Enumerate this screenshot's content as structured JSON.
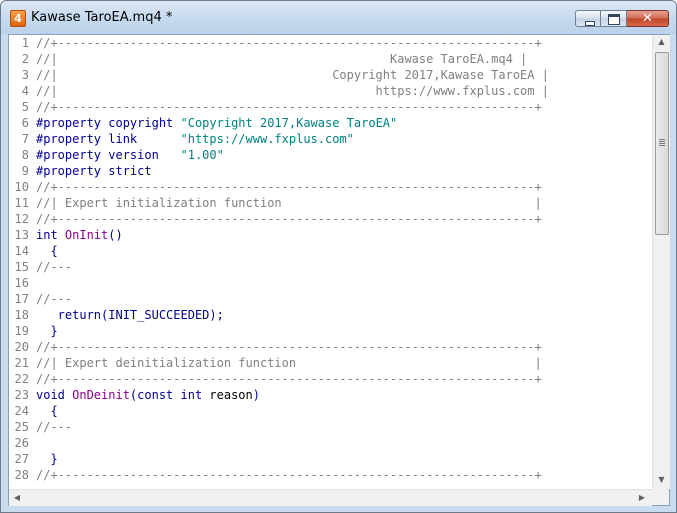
{
  "window": {
    "title": "Kawase TaroEA.mq4 *",
    "app_icon_glyph": "4",
    "close_glyph": "✕"
  },
  "colors": {
    "comment": "#808080",
    "keyword": "#00008b",
    "string": "#008080",
    "function": "#8b008b",
    "plain": "#000000"
  },
  "scrollbar": {
    "up_arrow": "▲",
    "down_arrow": "▼",
    "left_arrow": "◀",
    "right_arrow": "▶"
  },
  "editor": {
    "lines": [
      {
        "n": "1",
        "tokens": [
          {
            "t": "//+------------------------------------------------------------------+",
            "c": "comment"
          }
        ]
      },
      {
        "n": "2",
        "tokens": [
          {
            "t": "//|                                              Kawase TaroEA.mq4 |",
            "c": "comment"
          }
        ]
      },
      {
        "n": "3",
        "tokens": [
          {
            "t": "//|                                      Copyright 2017,Kawase TaroEA |",
            "c": "comment"
          }
        ]
      },
      {
        "n": "4",
        "tokens": [
          {
            "t": "//|                                            https://www.fxplus.com |",
            "c": "comment"
          }
        ]
      },
      {
        "n": "5",
        "tokens": [
          {
            "t": "//+------------------------------------------------------------------+",
            "c": "comment"
          }
        ]
      },
      {
        "n": "6",
        "tokens": [
          {
            "t": "#property copyright ",
            "c": "keyword"
          },
          {
            "t": "\"Copyright 2017,Kawase TaroEA\"",
            "c": "string"
          }
        ]
      },
      {
        "n": "7",
        "tokens": [
          {
            "t": "#property link      ",
            "c": "keyword"
          },
          {
            "t": "\"https://www.fxplus.com\"",
            "c": "string"
          }
        ]
      },
      {
        "n": "8",
        "tokens": [
          {
            "t": "#property version   ",
            "c": "keyword"
          },
          {
            "t": "\"1.00\"",
            "c": "string"
          }
        ]
      },
      {
        "n": "9",
        "tokens": [
          {
            "t": "#property strict",
            "c": "keyword"
          }
        ]
      },
      {
        "n": "10",
        "tokens": [
          {
            "t": "//+------------------------------------------------------------------+",
            "c": "comment"
          }
        ]
      },
      {
        "n": "11",
        "tokens": [
          {
            "t": "//| Expert initialization function                                   |",
            "c": "comment"
          }
        ]
      },
      {
        "n": "12",
        "tokens": [
          {
            "t": "//+------------------------------------------------------------------+",
            "c": "comment"
          }
        ]
      },
      {
        "n": "13",
        "tokens": [
          {
            "t": "int ",
            "c": "keyword"
          },
          {
            "t": "OnInit",
            "c": "function"
          },
          {
            "t": "()",
            "c": "keyword"
          }
        ]
      },
      {
        "n": "14",
        "tokens": [
          {
            "t": "  {",
            "c": "keyword"
          }
        ]
      },
      {
        "n": "15",
        "tokens": [
          {
            "t": "//---",
            "c": "comment"
          }
        ]
      },
      {
        "n": "16",
        "tokens": []
      },
      {
        "n": "17",
        "tokens": [
          {
            "t": "//---",
            "c": "comment"
          }
        ]
      },
      {
        "n": "18",
        "tokens": [
          {
            "t": "   return",
            "c": "keyword"
          },
          {
            "t": "(INIT_SUCCEEDED);",
            "c": "keyword"
          }
        ]
      },
      {
        "n": "19",
        "tokens": [
          {
            "t": "  }",
            "c": "keyword"
          }
        ]
      },
      {
        "n": "20",
        "tokens": [
          {
            "t": "//+------------------------------------------------------------------+",
            "c": "comment"
          }
        ]
      },
      {
        "n": "21",
        "tokens": [
          {
            "t": "//| Expert deinitialization function                                 |",
            "c": "comment"
          }
        ]
      },
      {
        "n": "22",
        "tokens": [
          {
            "t": "//+------------------------------------------------------------------+",
            "c": "comment"
          }
        ]
      },
      {
        "n": "23",
        "tokens": [
          {
            "t": "void ",
            "c": "keyword"
          },
          {
            "t": "OnDeinit",
            "c": "function"
          },
          {
            "t": "(const int ",
            "c": "keyword"
          },
          {
            "t": "reason",
            "c": "plain"
          },
          {
            "t": ")",
            "c": "keyword"
          }
        ]
      },
      {
        "n": "24",
        "tokens": [
          {
            "t": "  {",
            "c": "keyword"
          }
        ]
      },
      {
        "n": "25",
        "tokens": [
          {
            "t": "//---",
            "c": "comment"
          }
        ]
      },
      {
        "n": "26",
        "tokens": []
      },
      {
        "n": "27",
        "tokens": [
          {
            "t": "  }",
            "c": "keyword"
          }
        ]
      },
      {
        "n": "28",
        "tokens": [
          {
            "t": "//+------------------------------------------------------------------+",
            "c": "comment"
          }
        ]
      }
    ]
  }
}
